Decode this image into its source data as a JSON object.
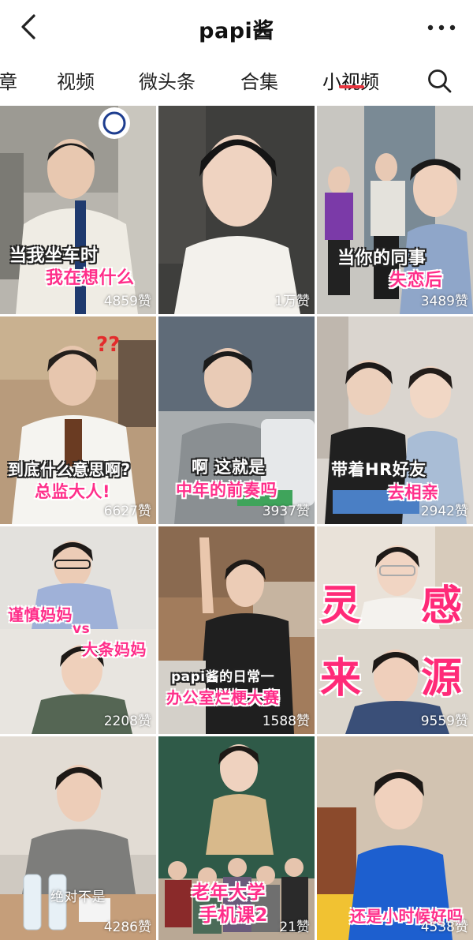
{
  "header": {
    "title": "papi酱"
  },
  "tabs": [
    {
      "label": "章"
    },
    {
      "label": "视频"
    },
    {
      "label": "微头条"
    },
    {
      "label": "合集"
    },
    {
      "label": "小视频",
      "active": true
    }
  ],
  "accent_color": "#e8353f",
  "videos": [
    {
      "captions": [
        "当我坐车时",
        "我在想什么"
      ],
      "likes": "4859赞"
    },
    {
      "captions": [],
      "likes": "1万赞"
    },
    {
      "captions": [
        "当你的同事",
        "失恋后"
      ],
      "likes": "3489赞"
    },
    {
      "captions": [
        "到底什么意思啊?",
        "总监大人!"
      ],
      "likes": "6627赞"
    },
    {
      "captions": [
        "啊 这就是",
        "中年的前奏吗"
      ],
      "likes": "3937赞"
    },
    {
      "captions": [
        "带着HR好友",
        "去相亲"
      ],
      "likes": "2942赞"
    },
    {
      "captions": [
        "谨慎妈妈",
        "vs",
        "大条妈妈"
      ],
      "likes": "2208赞"
    },
    {
      "captions": [
        "papi酱的日常一",
        "办公室烂梗大赛"
      ],
      "likes": "1588赞"
    },
    {
      "captions": [
        "灵",
        "感",
        "来",
        "源"
      ],
      "likes": "9559赞"
    },
    {
      "captions": [
        "绝对不是"
      ],
      "likes": "4286赞"
    },
    {
      "captions": [
        "老年大学",
        "手机课2"
      ],
      "likes": "21赞"
    },
    {
      "captions": [
        "还是小时候好吗"
      ],
      "likes": "4538赞"
    }
  ],
  "icons": {
    "back": "chevron-left-icon",
    "more": "more-dots-icon",
    "search": "search-icon"
  }
}
